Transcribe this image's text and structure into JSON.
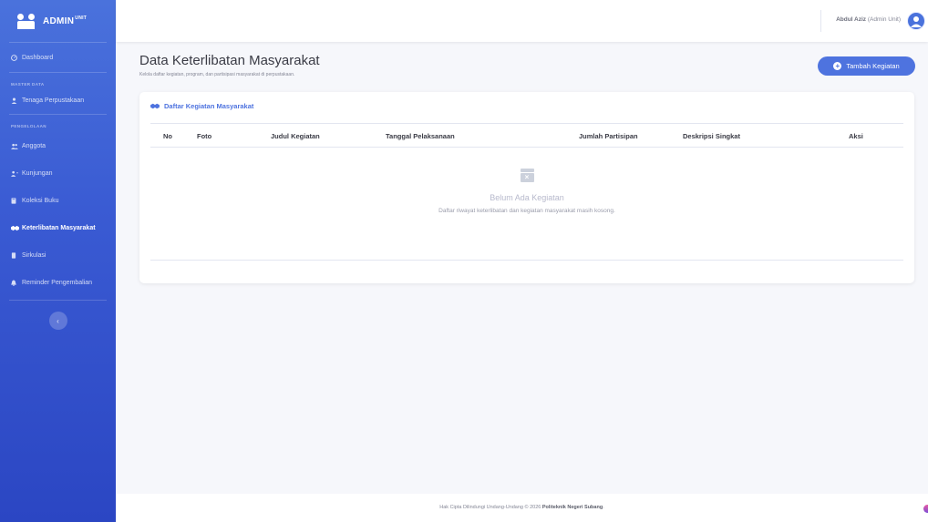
{
  "brand": {
    "name": "ADMIN",
    "badge": "UNIT"
  },
  "sidebar": {
    "dashboard": "Dashboard",
    "section_master": "MASTER DATA",
    "tenaga": "Tenaga Perpustakaan",
    "section_pengelolaan": "PENGELOLAAN",
    "items": [
      {
        "label": "Anggota",
        "icon": "users-icon"
      },
      {
        "label": "Kunjungan",
        "icon": "user-walk-icon"
      },
      {
        "label": "Koleksi Buku",
        "icon": "book-icon"
      },
      {
        "label": "Keterlibatan Masyarakat",
        "icon": "handshake-icon",
        "active": true
      },
      {
        "label": "Sirkulasi",
        "icon": "exchange-icon"
      },
      {
        "label": "Reminder Pengembalian",
        "icon": "bell-icon"
      }
    ],
    "toggle": "‹"
  },
  "topbar": {
    "user_name": "Abdul Aziz",
    "user_role": "(Admin Unit)"
  },
  "page": {
    "title": "Data Keterlibatan Masyarakat",
    "subtitle": "Kelola daftar kegiatan, program, dan partisipasi masyarakat di perpustakaan.",
    "add_button": "Tambah Kegiatan"
  },
  "card": {
    "title": "Daftar Kegiatan Masyarakat",
    "columns": [
      "No",
      "Foto",
      "Judul Kegiatan",
      "Tanggal Pelaksanaan",
      "Jumlah Partisipan",
      "Deskripsi Singkat",
      "Aksi"
    ],
    "empty_title": "Belum Ada Kegiatan",
    "empty_text": "Daftar riwayat keterlibatan dan kegiatan masyarakat masih kosong."
  },
  "footer": {
    "text": "Hak Cipta Dilindungi Undang-Undang © 2026",
    "org": "Politeknik Negeri Subang"
  },
  "colors": {
    "primary": "#4e73df",
    "sidebar_top": "#4a72dc",
    "sidebar_bottom": "#2b46c3"
  }
}
